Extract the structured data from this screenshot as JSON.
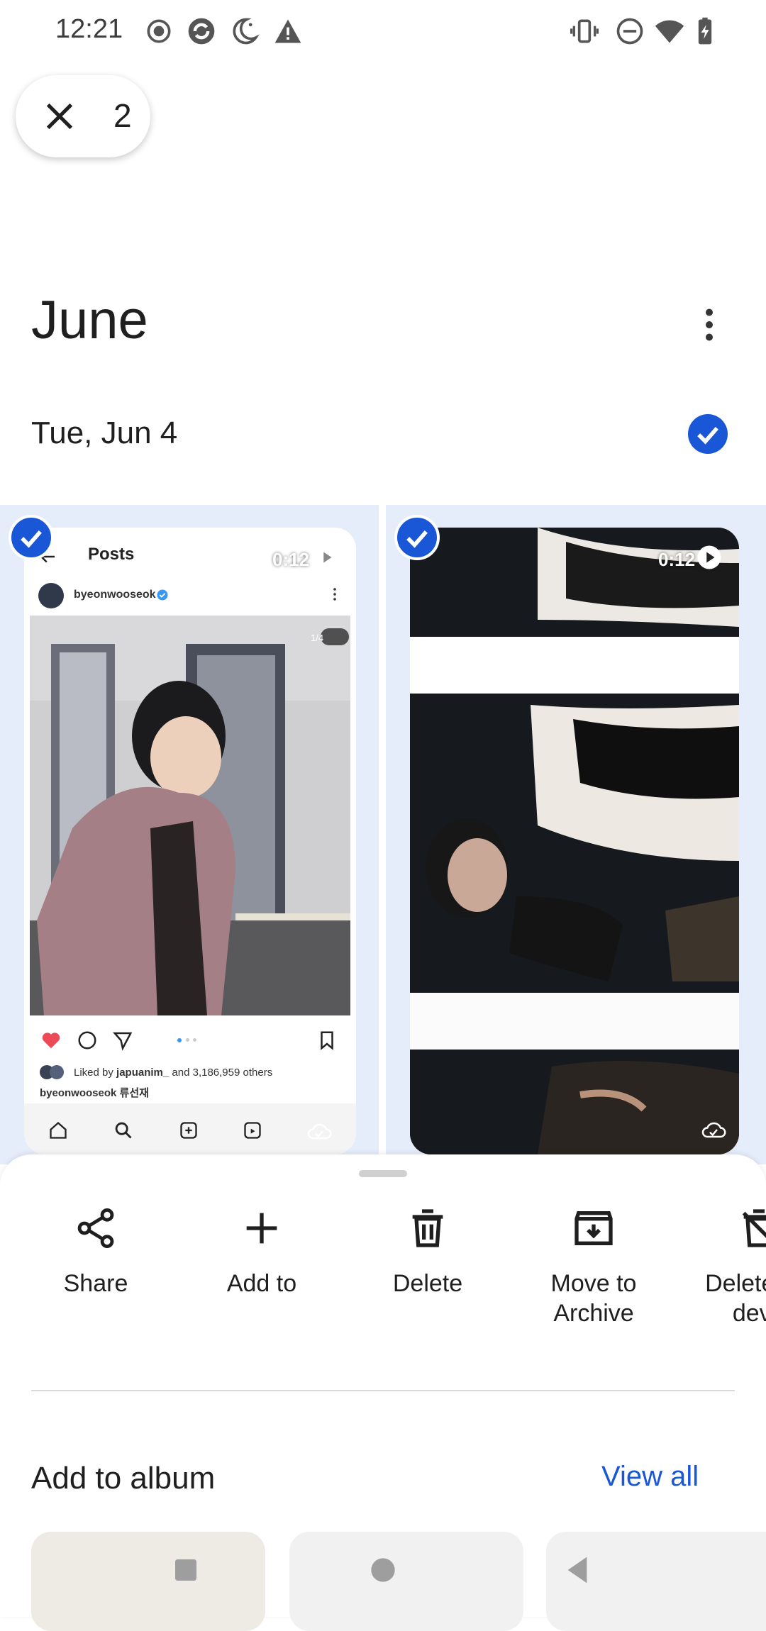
{
  "status_bar": {
    "time": "12:21",
    "icons_left": [
      "record-icon",
      "sync-icon",
      "night-mode-icon",
      "alert-icon"
    ],
    "icons_right": [
      "vibrate-icon",
      "do-not-disturb-icon",
      "wifi-icon",
      "battery-charging-icon"
    ]
  },
  "selection": {
    "count": "2"
  },
  "header": {
    "month": "June"
  },
  "section": {
    "date": "Tue, Jun 4"
  },
  "items": [
    {
      "duration": "0:12",
      "post": {
        "title": "Posts",
        "username": "byeonwooseok",
        "page_indicator": "1/4",
        "liked_prefix": "Liked by",
        "liked_user": "japuanim_",
        "liked_suffix": "and 3,186,959 others",
        "caption": "byeonwooseok 류선재"
      }
    },
    {
      "duration": "0:12"
    }
  ],
  "actions": [
    {
      "label": "Share"
    },
    {
      "label": "Add to"
    },
    {
      "label": "Delete"
    },
    {
      "label": "Move to Archive"
    },
    {
      "label": "Delete from device"
    }
  ],
  "album_section": {
    "title": "Add to album",
    "view_all": "View all"
  },
  "colors": {
    "accent": "#1a57d6",
    "selection_bg": "#e5ecfa"
  }
}
